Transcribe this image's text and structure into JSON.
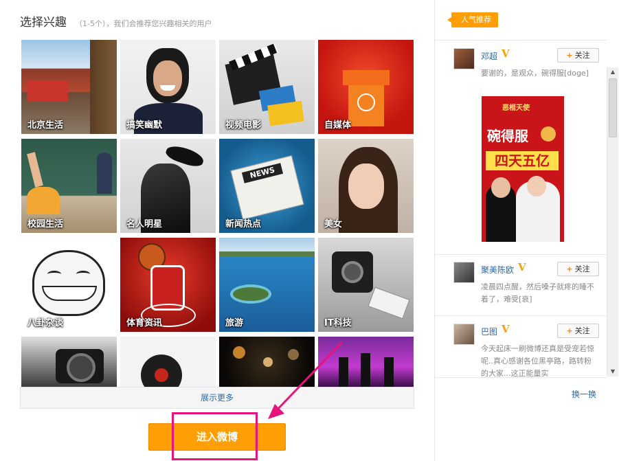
{
  "header": {
    "title": "选择兴趣",
    "subtitle": "（1-5个），我们会推荐您兴趣相关的用户"
  },
  "interests": [
    {
      "label": "北京生活"
    },
    {
      "label": "搞笑幽默"
    },
    {
      "label": "视频电影"
    },
    {
      "label": "自媒体"
    },
    {
      "label": "校园生活"
    },
    {
      "label": "名人明星"
    },
    {
      "label": "新闻热点"
    },
    {
      "label": "美女"
    },
    {
      "label": "八卦杂谈"
    },
    {
      "label": "体育资讯"
    },
    {
      "label": "旅游"
    },
    {
      "label": "IT科技"
    },
    {
      "label": ""
    },
    {
      "label": ""
    },
    {
      "label": ""
    },
    {
      "label": ""
    }
  ],
  "show_more": "展示更多",
  "enter_button": "进入微博",
  "sidebar": {
    "tag": "人气推荐",
    "follow_label": "关注",
    "users": [
      {
        "name": "邓超",
        "text": "要谢的，是观众，碗得服[doge]"
      },
      {
        "name": "聚美陈欧",
        "text": "凌晨四点醒，然后嗓子就疼的睡不着了，难受[衰]"
      },
      {
        "name": "巴图",
        "text": "今天起床一刷微博还真是受宠若惊呢..真心感谢各位黑亭路，路转粉的大家...这正能量实"
      }
    ],
    "poster": {
      "line1": "碗得服",
      "line2": "四天五亿",
      "logo": "恶棍天使"
    },
    "refresh": "换一换"
  },
  "colors": {
    "accent": "#ff9e05",
    "link": "#2d6aa6",
    "highlight": "#e8137c"
  }
}
